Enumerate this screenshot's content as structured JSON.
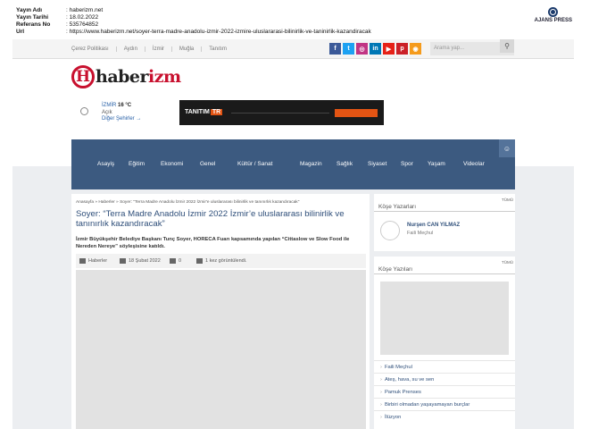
{
  "meta": {
    "rows": [
      {
        "key": "Yayın Adı",
        "value": ": haberizm.net"
      },
      {
        "key": "Yayın Tarihi",
        "value": ": 18.02.2022"
      },
      {
        "key": "Referans No",
        "value": ": 535764852"
      },
      {
        "key": "Url",
        "value": ": https://www.haberizm.net/soyer-terra-madre-anadolu-izmir-2022-izmire-uluslararasi-bilinirlik-ve-taninirlik-kazandiracak"
      }
    ],
    "agency": "AJANS PRESS"
  },
  "topbar": {
    "links": [
      "Çerez Politikası",
      "Aydın",
      "İzmir",
      "Muğla",
      "Tanıtım"
    ],
    "socials": [
      {
        "icon": "facebook-icon",
        "glyph": "f",
        "color": "#3b5998"
      },
      {
        "icon": "twitter-icon",
        "glyph": "t",
        "color": "#1da1f2"
      },
      {
        "icon": "instagram-icon",
        "glyph": "◎",
        "color": "#c13584"
      },
      {
        "icon": "linkedin-icon",
        "glyph": "in",
        "color": "#0077b5"
      },
      {
        "icon": "youtube-icon",
        "glyph": "▶",
        "color": "#e62117"
      },
      {
        "icon": "pinterest-icon",
        "glyph": "p",
        "color": "#cb2027"
      },
      {
        "icon": "rss-icon",
        "glyph": "◉",
        "color": "#f59b1c"
      }
    ],
    "search_placeholder": "Arama yap..."
  },
  "logo": {
    "h": "H",
    "text_a": "haber",
    "text_b": "izm"
  },
  "weather": {
    "city": "İZMİR",
    "temp": "16 °C",
    "condition": "Açık",
    "others": "Diğer Şehirler →"
  },
  "banner": {
    "text": "TANITIM",
    "badge": "TR"
  },
  "nav": {
    "items": [
      "Asayiş",
      "Eğitim",
      "Ekonomi",
      "Genel",
      "Kültür / Sanat",
      "Magazin",
      "Sağlık",
      "Siyaset",
      "Spor",
      "Yaşam",
      "Videolar"
    ]
  },
  "article": {
    "breadcrumb": "Anasayfa » Haberler » Soyer: \"Terra Madre Anadolu İzmir 2022 İzmir'e uluslararası bilinirlik ve tanınırlık kazandıracak\"",
    "title": "Soyer: “Terra Madre Anadolu İzmir 2022 İzmir’e uluslararası bilinirlik ve tanınırlık kazandıracak”",
    "lead": "İzmir Büyükşehir Belediye Başkanı Tunç Soyer, HORECA Fuarı kapsamında yapılan “Cittaslow ve Slow Food ile Nereden Nereye” söyleşisine katıldı.",
    "category": "Haberler",
    "date": "18 Şubat 2022",
    "comments": "0",
    "views": "1 kez görüntülendi."
  },
  "sidebar": {
    "authors": {
      "tag": "TÜMÜ",
      "title": "Köşe Yazarları",
      "name": "Nurşen CAN YILMAZ",
      "sub": "Faili Meçhul"
    },
    "columns": {
      "tag": "TÜMÜ",
      "title": "Köşe Yazıları",
      "items": [
        "Faili Meçhul",
        "Ateş, hava, su ve sen",
        "Pamuk Prenses",
        "Birbiri olmadan yaşayamayan burçlar",
        "İlüzyon"
      ]
    }
  }
}
